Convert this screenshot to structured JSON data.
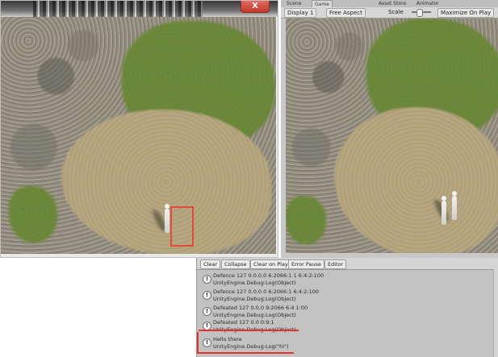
{
  "scene_window": {
    "close_label": "X"
  },
  "game_window": {
    "tabs": [
      "Scene",
      "Game",
      "Asset Store",
      "Animator"
    ],
    "display_label": "Display 1",
    "aspect_label": "Free Aspect",
    "scale_label": "Scale",
    "maximize_label": "Maximize On Play"
  },
  "console": {
    "toolbar": {
      "clear_label": "Clear",
      "collapse_label": "Collapse",
      "clear_on_play_label": "Clear on Play",
      "error_pause_label": "Error Pause",
      "editor_label": "Editor"
    },
    "entries": [
      {
        "line1": "Defence 127 0.0.0.0 6:2066:1 1 6:4:2:100",
        "line2": "UnityEngine.Debug:Log(Object)"
      },
      {
        "line1": "Defence 127 0.0.0.0 6:2066:1 6:4:2:100",
        "line2": "UnityEngine.Debug:Log(Object)"
      },
      {
        "line1": "Defeated 127 0.0.0 9:2066 6:4 1:00",
        "line2": "UnityEngine.Debug:Log(Object)"
      },
      {
        "line1": "Defeated 127 0.0 0:9:1",
        "line2": "UnityEngine.Debug:Log(Object)"
      },
      {
        "line1": "Hello there",
        "line2": "UnityEngine.Debug:Log(\"hi\")"
      }
    ],
    "accent_color": "#e3322a"
  },
  "icons": [
    "close-icon",
    "info-icon",
    "slider-handle"
  ]
}
